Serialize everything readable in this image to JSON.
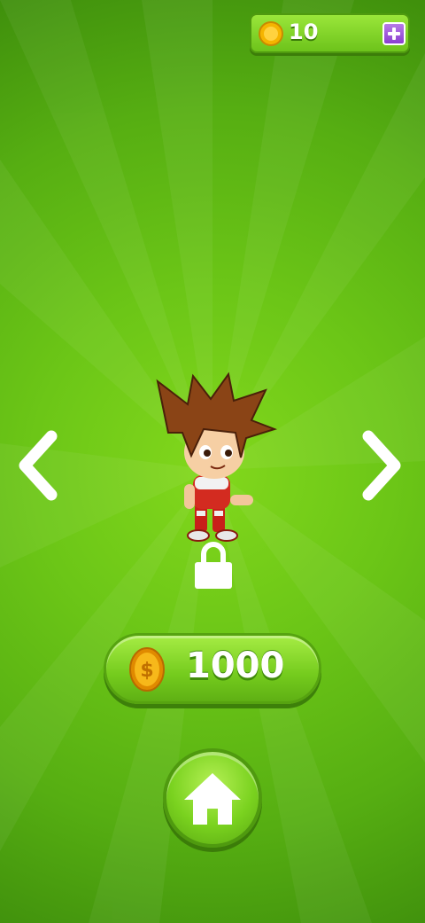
{
  "header": {
    "coin_count": "10",
    "coin_icon": "coin-icon",
    "add_coins_icon": "plus-icon"
  },
  "navigation": {
    "prev_icon": "chevron-left-icon",
    "next_icon": "chevron-right-icon"
  },
  "character": {
    "locked": true,
    "lock_icon": "lock-icon"
  },
  "purchase": {
    "price": "1000",
    "currency_icon": "dollar-coin-icon"
  },
  "home": {
    "icon": "home-icon"
  },
  "colors": {
    "background": "#6cc617",
    "button_green": "#7ad21f",
    "coin_gold": "#f5b400",
    "plus_purple": "#8a3fcf"
  }
}
